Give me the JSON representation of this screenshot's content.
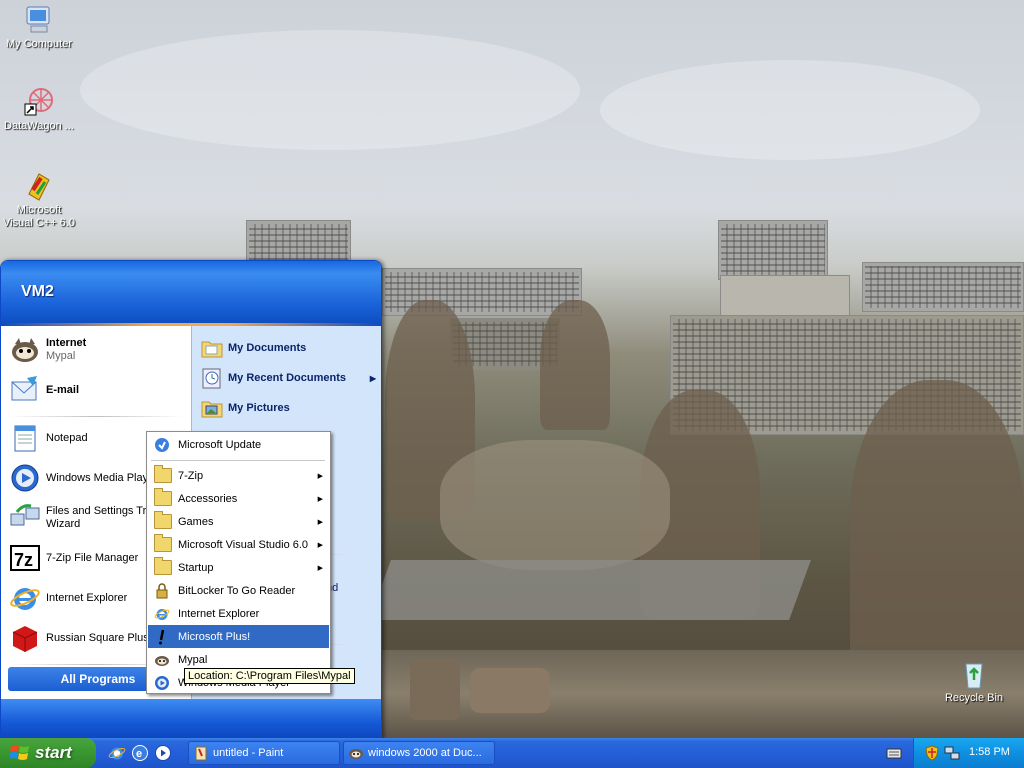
{
  "desktop": {
    "icons": [
      {
        "label": "My Computer",
        "icon": "my-computer-icon"
      },
      {
        "label": "DataWagon ...",
        "icon": "datawagon-icon"
      },
      {
        "label": "Microsoft Visual C++ 6.0",
        "icon": "visual-cpp-icon"
      },
      {
        "label": "Recycle Bin",
        "icon": "recycle-bin-icon"
      }
    ]
  },
  "start_menu": {
    "user_name": "VM2",
    "pinned": [
      {
        "title": "Internet",
        "subtitle": "Mypal"
      },
      {
        "title": "E-mail",
        "subtitle": ""
      }
    ],
    "recent": [
      {
        "label": "Notepad"
      },
      {
        "label": "Windows Media Player"
      },
      {
        "label": "Files and Settings Transfer Wizard"
      },
      {
        "label": "7-Zip File Manager"
      },
      {
        "label": "Internet Explorer"
      },
      {
        "label": "Russian Square Plus!"
      }
    ],
    "all_programs_label": "All Programs",
    "right": [
      {
        "label": "My Documents",
        "submenu": false
      },
      {
        "label": "My Recent Documents",
        "submenu": true
      },
      {
        "label": "My Pictures",
        "submenu": false
      }
    ],
    "right_partial_text": "nd"
  },
  "programs_submenu": {
    "items": [
      {
        "label": "Microsoft Update",
        "submenu": false
      },
      {
        "label": "7-Zip",
        "submenu": true
      },
      {
        "label": "Accessories",
        "submenu": true
      },
      {
        "label": "Games",
        "submenu": true
      },
      {
        "label": "Microsoft Visual Studio 6.0",
        "submenu": true
      },
      {
        "label": "Startup",
        "submenu": true
      },
      {
        "label": "BitLocker To Go Reader",
        "submenu": false
      },
      {
        "label": "Internet Explorer",
        "submenu": false
      },
      {
        "label": "Microsoft Plus!",
        "submenu": false,
        "selected": true
      },
      {
        "label": "Mypal",
        "submenu": false
      },
      {
        "label": "Windows Media Player",
        "submenu": false
      }
    ],
    "tooltip": "Location: C:\\Program Files\\Mypal"
  },
  "taskbar": {
    "start_label": "start",
    "tasks": [
      {
        "label": "untitled - Paint"
      },
      {
        "label": "windows 2000 at Duc..."
      }
    ],
    "clock": "1:58 PM"
  },
  "colors": {
    "taskbar_blue": "#245ed8",
    "start_green": "#3c9a32",
    "submenu_selected": "#316ac5",
    "tray_blue": "#0f8fe0"
  }
}
